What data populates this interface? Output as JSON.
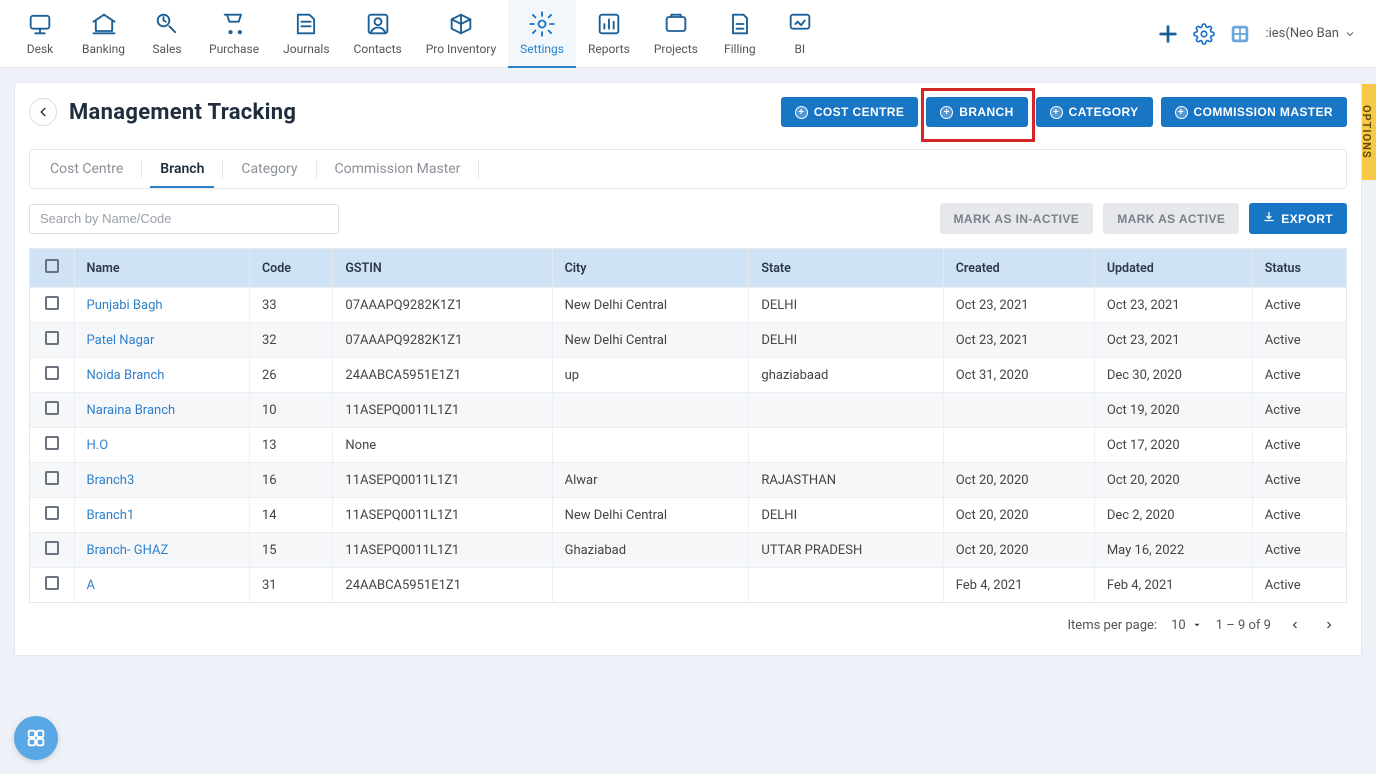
{
  "nav": [
    {
      "label": "Desk",
      "icon": "desk"
    },
    {
      "label": "Banking",
      "icon": "bank"
    },
    {
      "label": "Sales",
      "icon": "sales"
    },
    {
      "label": "Purchase",
      "icon": "purchase"
    },
    {
      "label": "Journals",
      "icon": "journals"
    },
    {
      "label": "Contacts",
      "icon": "contacts"
    },
    {
      "label": "Pro Inventory",
      "icon": "inventory"
    },
    {
      "label": "Settings",
      "icon": "settings",
      "active": true
    },
    {
      "label": "Reports",
      "icon": "reports"
    },
    {
      "label": "Projects",
      "icon": "projects"
    },
    {
      "label": "Filling",
      "icon": "filling"
    },
    {
      "label": "BI",
      "icon": "bi"
    }
  ],
  "org_label": ":ies(Neo Ban",
  "page_title": "Management Tracking",
  "action_buttons": {
    "cost_centre": "COST CENTRE",
    "branch": "BRANCH",
    "category": "CATEGORY",
    "commission_master": "COMMISSION MASTER"
  },
  "tabs": [
    {
      "label": "Cost Centre"
    },
    {
      "label": "Branch",
      "active": true
    },
    {
      "label": "Category"
    },
    {
      "label": "Commission Master"
    }
  ],
  "search_placeholder": "Search by Name/Code",
  "bulk_buttons": {
    "inactive": "MARK AS IN-ACTIVE",
    "active": "MARK AS ACTIVE",
    "export": "EXPORT"
  },
  "columns": [
    "Name",
    "Code",
    "GSTIN",
    "City",
    "State",
    "Created",
    "Updated",
    "Status"
  ],
  "rows": [
    {
      "name": "Punjabi Bagh",
      "code": "33",
      "gstin": "07AAAPQ9282K1Z1",
      "city": "New Delhi Central",
      "state": "DELHI",
      "created": "Oct 23, 2021",
      "updated": "Oct 23, 2021",
      "status": "Active"
    },
    {
      "name": "Patel Nagar",
      "code": "32",
      "gstin": "07AAAPQ9282K1Z1",
      "city": "New Delhi Central",
      "state": "DELHI",
      "created": "Oct 23, 2021",
      "updated": "Oct 23, 2021",
      "status": "Active"
    },
    {
      "name": "Noida Branch",
      "code": "26",
      "gstin": "24AABCA5951E1Z1",
      "city": "up",
      "state": "ghaziabaad",
      "created": "Oct 31, 2020",
      "updated": "Dec 30, 2020",
      "status": "Active"
    },
    {
      "name": "Naraina Branch",
      "code": "10",
      "gstin": "11ASEPQ0011L1Z1",
      "city": "",
      "state": "",
      "created": "",
      "updated": "Oct 19, 2020",
      "status": "Active"
    },
    {
      "name": "H.O",
      "code": "13",
      "gstin": "None",
      "city": "",
      "state": "",
      "created": "",
      "updated": "Oct 17, 2020",
      "status": "Active"
    },
    {
      "name": "Branch3",
      "code": "16",
      "gstin": "11ASEPQ0011L1Z1",
      "city": "Alwar",
      "state": "RAJASTHAN",
      "created": "Oct 20, 2020",
      "updated": "Oct 20, 2020",
      "status": "Active"
    },
    {
      "name": "Branch1",
      "code": "14",
      "gstin": "11ASEPQ0011L1Z1",
      "city": "New Delhi Central",
      "state": "DELHI",
      "created": "Oct 20, 2020",
      "updated": "Dec 2, 2020",
      "status": "Active"
    },
    {
      "name": "Branch- GHAZ",
      "code": "15",
      "gstin": "11ASEPQ0011L1Z1",
      "city": "Ghaziabad",
      "state": "UTTAR PRADESH",
      "created": "Oct 20, 2020",
      "updated": "May 16, 2022",
      "status": "Active"
    },
    {
      "name": "A",
      "code": "31",
      "gstin": "24AABCA5951E1Z1",
      "city": "",
      "state": "",
      "created": "Feb 4, 2021",
      "updated": "Feb 4, 2021",
      "status": "Active"
    }
  ],
  "paginator": {
    "label": "Items per page:",
    "per_page": "10",
    "range": "1 – 9 of 9"
  },
  "options_tab": "OPTIONS"
}
